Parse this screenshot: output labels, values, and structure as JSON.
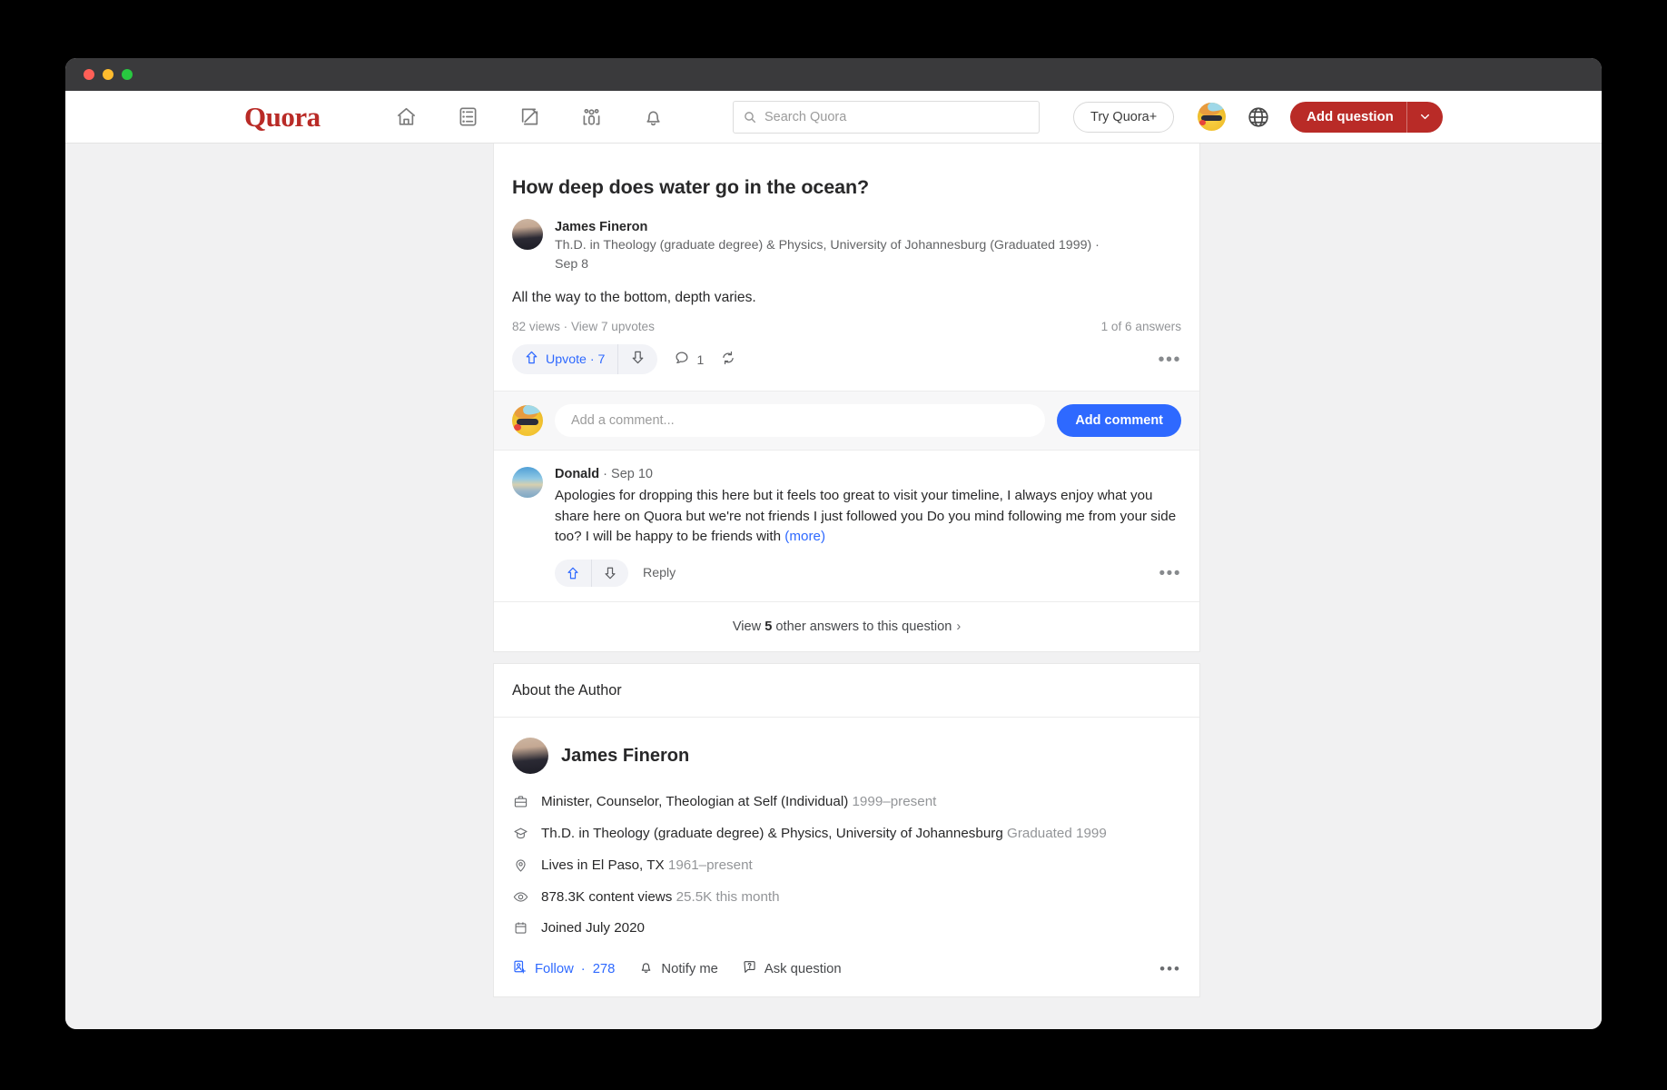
{
  "window": {
    "traffic_lights": [
      "close",
      "minimize",
      "maximize"
    ]
  },
  "nav": {
    "brand": "Quora",
    "icons": [
      {
        "name": "home-icon",
        "label": "Home"
      },
      {
        "name": "following-icon",
        "label": "Following"
      },
      {
        "name": "answer-icon",
        "label": "Answer"
      },
      {
        "name": "spaces-icon",
        "label": "Spaces"
      },
      {
        "name": "notifications-icon",
        "label": "Notifications"
      }
    ],
    "search": {
      "placeholder": "Search Quora",
      "value": "",
      "icon": "search-icon"
    },
    "try_plus_label": "Try Quora+",
    "language_icon": "globe-icon",
    "add_question_label": "Add question",
    "add_question_caret": "chevron-down-icon",
    "brand_color": "#b92b27",
    "accent_color": "#2e69ff"
  },
  "answer": {
    "question_title": "How deep does water go in the ocean?",
    "author": {
      "name": "James Fineron",
      "credential": "Th.D. in Theology (graduate degree) & Physics, University of Johannesburg (Graduated 1999) ·",
      "date": "Sep 8"
    },
    "body": "All the way to the bottom, depth varies.",
    "stats_left": "82 views · View 7 upvotes",
    "stats_right": "1 of 6 answers",
    "upvote_label": "Upvote · 7",
    "downvote_icon": "downvote-arrow-icon",
    "comment_count": "1",
    "comment_icon": "comment-bubble-icon",
    "share_icon": "repost-icon",
    "more_icon": "ellipsis-icon"
  },
  "composer": {
    "placeholder": "Add a comment...",
    "value": "",
    "button_label": "Add comment"
  },
  "comment": {
    "author": "Donald",
    "separator": " · ",
    "date": "Sep 10",
    "text": "Apologies for dropping this here but it feels too great to visit your timeline, I always enjoy what you share here on Quora but we're not friends I just followed you Do you mind following me from your side too? I will be happy to be friends with",
    "more_label": "(more)",
    "reply_label": "Reply",
    "upvote_icon": "upvote-arrow-icon",
    "downvote_icon": "downvote-arrow-icon",
    "more_icon": "ellipsis-icon"
  },
  "view_others": {
    "prefix": "View ",
    "count": "5",
    "suffix": " other answers to this question",
    "caret": "chevron-right-icon"
  },
  "about": {
    "heading": "About the Author",
    "name": "James Fineron",
    "credentials": [
      {
        "icon": "briefcase-icon",
        "main": "Minister, Counselor, Theologian at Self (Individual)",
        "sub": "1999–present"
      },
      {
        "icon": "graduation-cap-icon",
        "main": "Th.D. in Theology (graduate degree) & Physics, University of Johannesburg",
        "sub": "Graduated 1999"
      },
      {
        "icon": "location-pin-icon",
        "main": "Lives in El Paso, TX",
        "sub": "1961–present"
      },
      {
        "icon": "eye-icon",
        "main": "878.3K content views",
        "sub": "25.5K this month"
      },
      {
        "icon": "calendar-icon",
        "main": "Joined July 2020",
        "sub": ""
      }
    ],
    "actions": {
      "follow_label": "Follow",
      "follow_sep": " · ",
      "follow_count": "278",
      "notify_label": "Notify me",
      "ask_label": "Ask question",
      "follow_icon": "add-person-icon",
      "notify_icon": "bell-icon",
      "ask_icon": "question-bubble-icon",
      "more_icon": "ellipsis-icon"
    }
  }
}
